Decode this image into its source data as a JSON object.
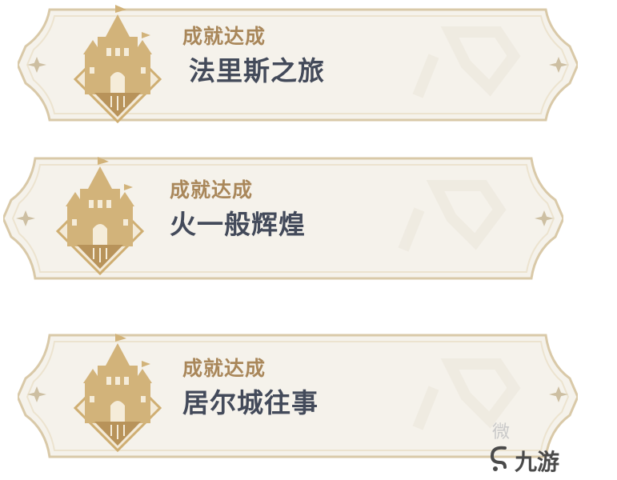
{
  "cards": [
    {
      "subtitle": "成就达成",
      "title": "法里斯之旅"
    },
    {
      "subtitle": "成就达成",
      "title": "火一般辉煌"
    },
    {
      "subtitle": "成就达成",
      "title": "居尔城往事"
    }
  ],
  "watermark": {
    "brand": "九游",
    "faint": "微"
  },
  "colors": {
    "card_bg": "#f4f1ea",
    "card_border": "#d8c8a6",
    "subtitle": "#a9875a",
    "title": "#434a5a",
    "badge_gold": "#cfae72"
  },
  "icons": [
    "castle-badge-icon",
    "sparkle-icon",
    "watermark-logo-icon"
  ]
}
